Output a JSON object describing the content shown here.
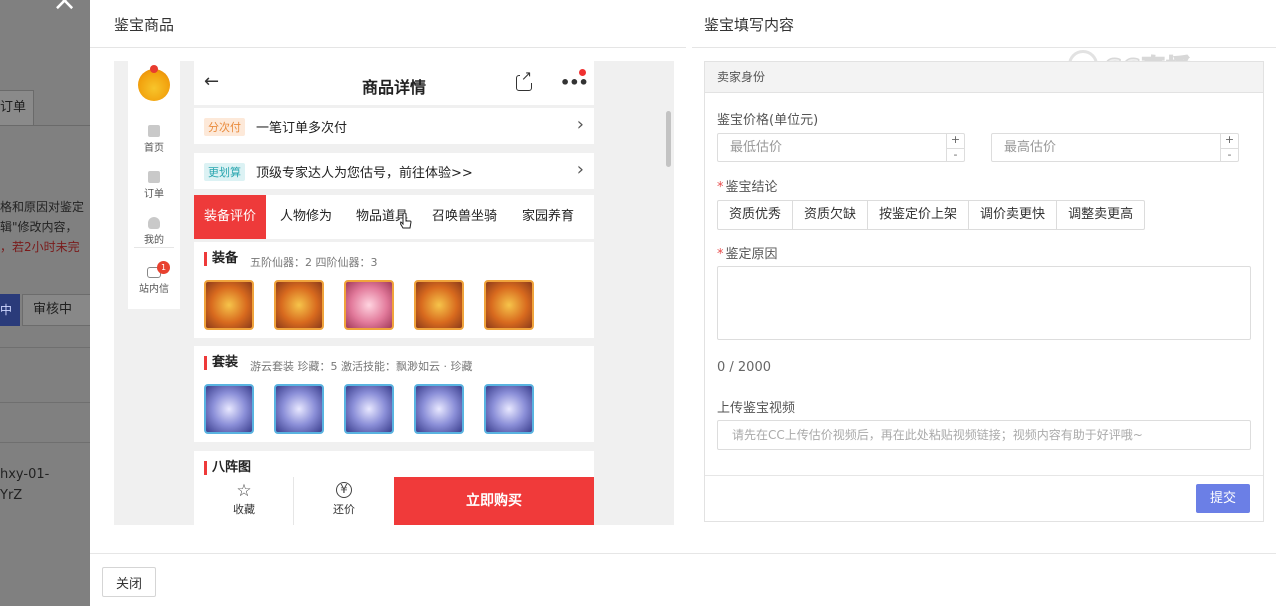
{
  "background": {
    "tab_label": "订单",
    "text_line1": "格和原因对鉴定",
    "text_line2": "辑\"修改内容，",
    "text_line3": "，若2小时未完",
    "btn_active": "中",
    "btn_review": "审核中",
    "code_line1": "hxy-01-",
    "code_line2": "YrZ"
  },
  "left_panel": {
    "title": "鉴宝商品"
  },
  "right_panel": {
    "title": "鉴宝填写内容"
  },
  "watermark": {
    "text": "CC直播"
  },
  "side_nav": {
    "items": [
      {
        "label": "首页"
      },
      {
        "label": "订单"
      },
      {
        "label": "我的"
      },
      {
        "label": "站内信",
        "badge": "1"
      }
    ]
  },
  "phone": {
    "title": "商品详情",
    "installment": {
      "tag": "分次付",
      "text": "一笔订单多次付"
    },
    "appraise": {
      "tag": "更划算",
      "text": "顶级专家达人为您估号，前往体验>>"
    },
    "tabs": [
      "装备评价",
      "人物修为",
      "物品道具",
      "召唤兽坐骑",
      "家园养育"
    ],
    "sections": [
      {
        "title": "装备",
        "meta": "五阶仙器：2   四阶仙器：3"
      },
      {
        "title": "套装",
        "meta": "游云套装   珍藏：5   激活技能：飘渺如云 · 珍藏"
      },
      {
        "title": "八阵图",
        "meta": ""
      }
    ],
    "bottom": {
      "favorite": "收藏",
      "bargain": "还价",
      "bargain_icon": "¥",
      "buy": "立即购买"
    }
  },
  "form": {
    "header": "卖家身份",
    "price_label": "鉴宝价格(单位元)",
    "min_placeholder": "最低估价",
    "max_placeholder": "最高估价",
    "conclusion_label": "鉴宝结论",
    "conclusions": [
      "资质优秀",
      "资质欠缺",
      "按鉴定价上架",
      "调价卖更快",
      "调整卖更高"
    ],
    "reason_label": "鉴定原因",
    "counter": "0 / 2000",
    "video_label": "上传鉴宝视频",
    "video_placeholder": "请先在CC上传估价视频后，再在此处粘贴视频链接；视频内容有助于好评哦~",
    "submit": "提交",
    "plus": "+",
    "minus": "-"
  },
  "footer": {
    "close": "关闭"
  },
  "colors": {
    "accent_red": "#f03a3a",
    "submit_blue": "#6b7fe6",
    "required": "#e84a4a"
  }
}
